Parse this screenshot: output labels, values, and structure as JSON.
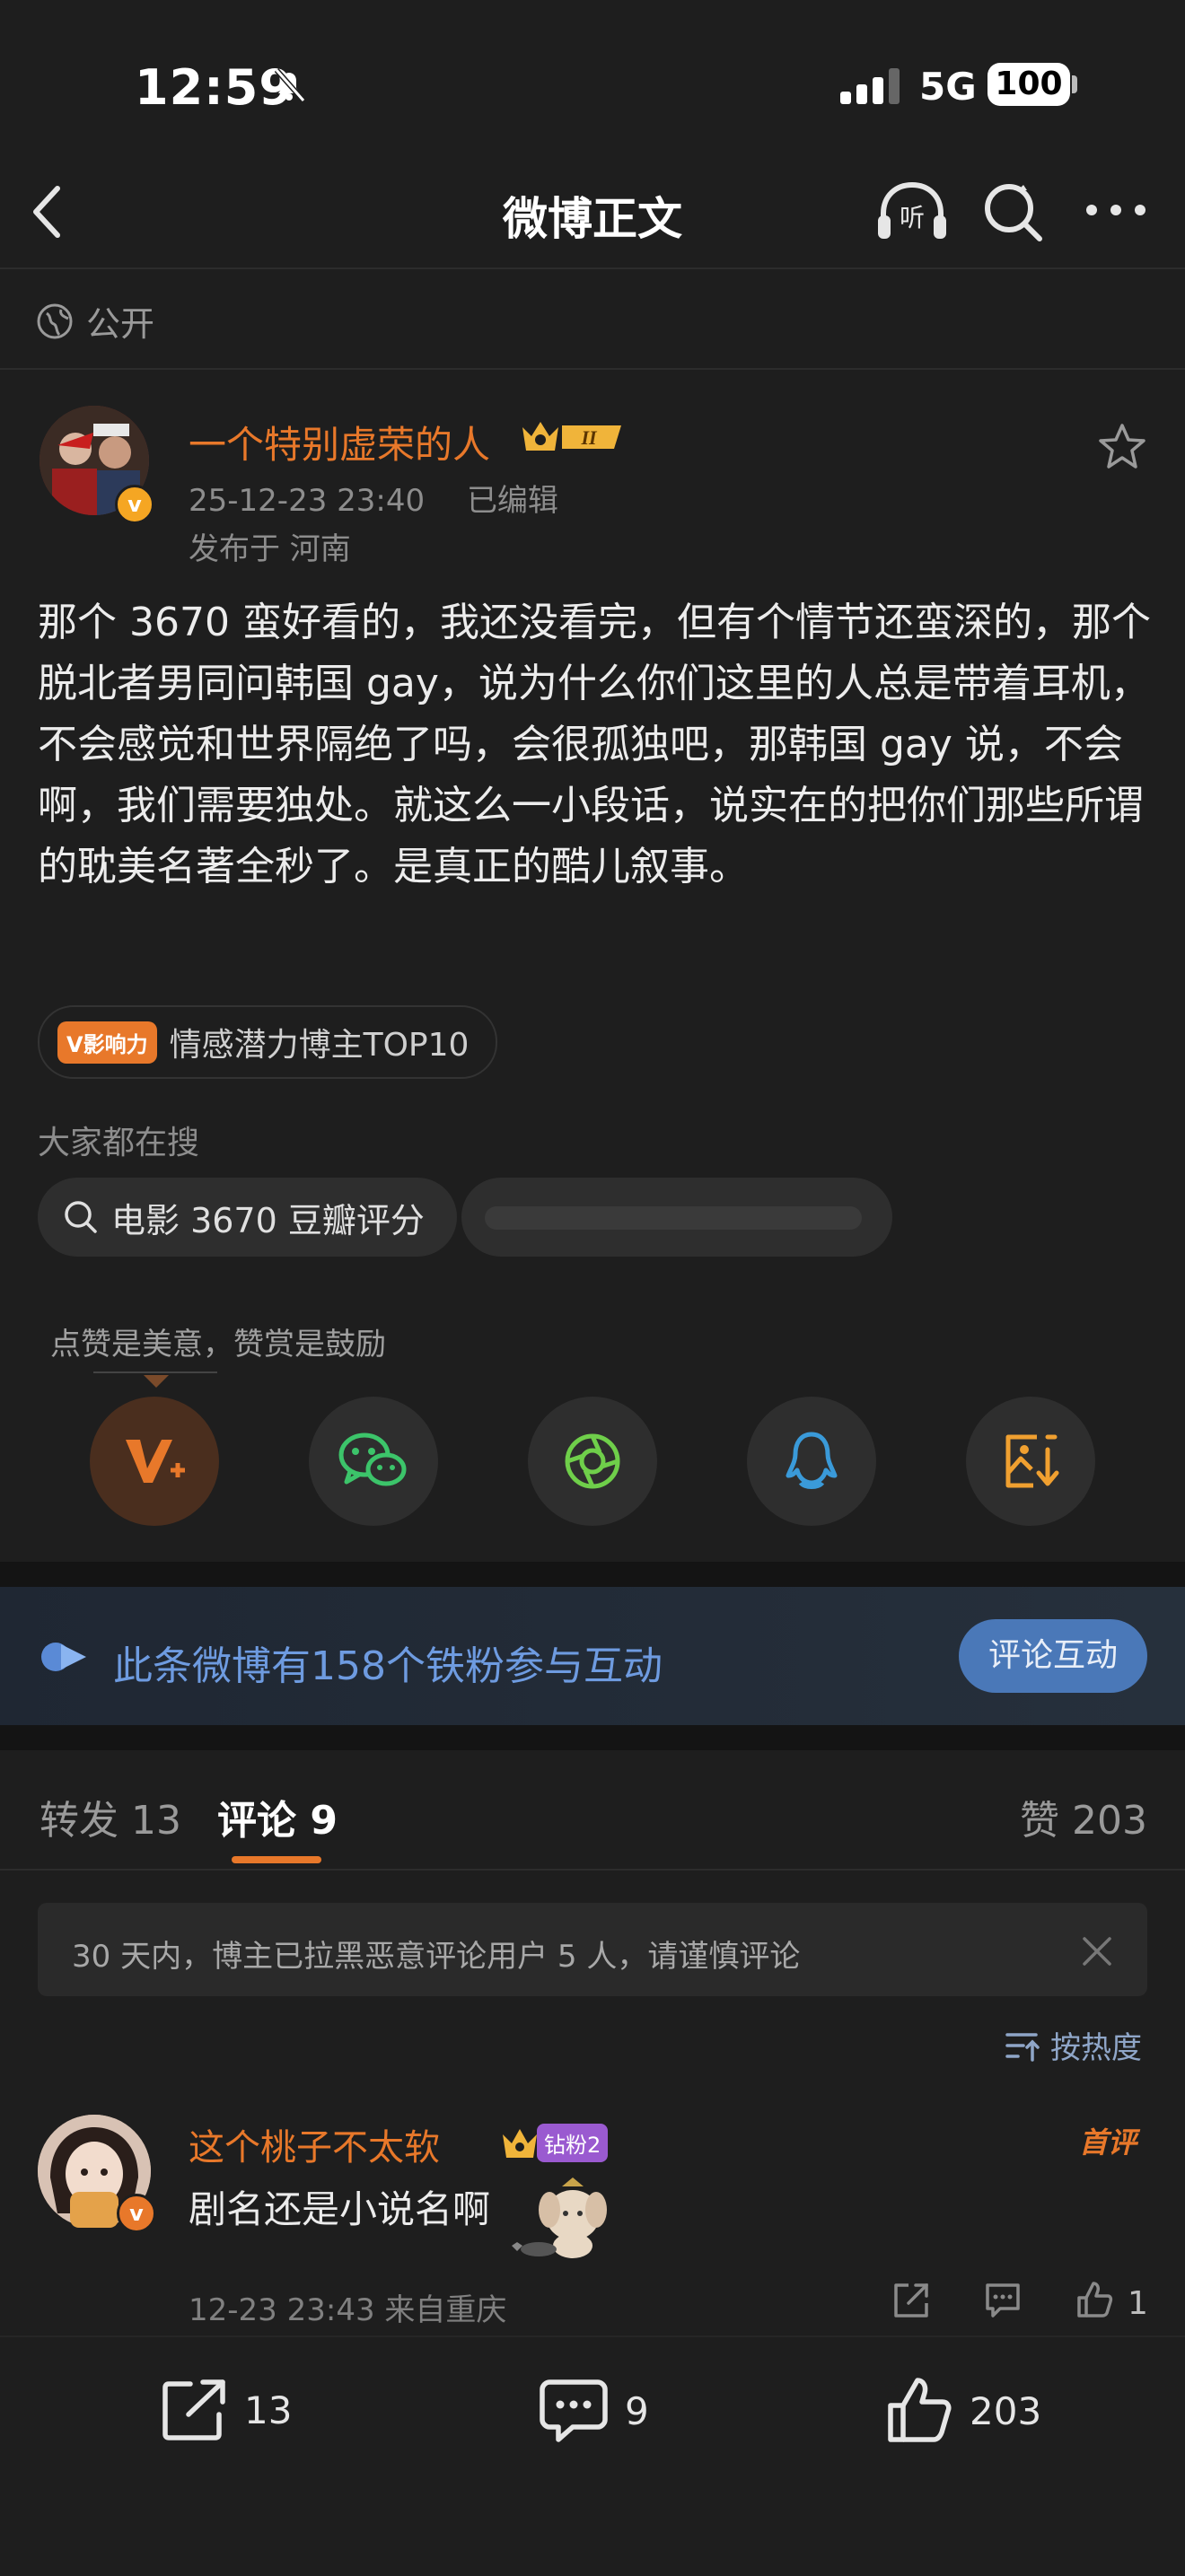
{
  "status_bar": {
    "time": "12:59",
    "network": "5G",
    "battery": "100"
  },
  "header": {
    "title": "微博正文",
    "listen_label": "听"
  },
  "visibility": "公开",
  "author": {
    "name": "一个特别虚荣的人",
    "level_badge": "II",
    "datetime": "25-12-23 23:40",
    "edited": "已编辑",
    "location": "发布于 河南"
  },
  "post": {
    "text": "那个 3670 蛮好看的，我还没看完，但有个情节还蛮深的，那个脱北者男同问韩国 gay，说为什么你们这里的人总是带着耳机，不会感觉和世界隔绝了吗，会很孤独吧，那韩国 gay 说，不会啊，我们需要独处。就这么一小段话，说实在的把你们那些所谓的耽美名著全秒了。是真正的酷儿叙事。"
  },
  "influence": {
    "tag": "V影响力",
    "label": "情感潜力博主TOP10"
  },
  "trending": {
    "label": "大家都在搜",
    "items": [
      "电影 3670 豆瓣评分"
    ]
  },
  "reward_hint": "点赞是美意，赞赏是鼓励",
  "share": {
    "items": [
      {
        "icon": "v-plus-reward-icon"
      },
      {
        "icon": "wechat-icon"
      },
      {
        "icon": "moments-icon"
      },
      {
        "icon": "qq-icon"
      },
      {
        "icon": "save-image-icon"
      }
    ]
  },
  "banner": {
    "text": "此条微博有158个铁粉参与互动",
    "button": "评论互动"
  },
  "tabs": {
    "repost": "转发 13",
    "comments": "评论 9",
    "likes": "赞 203"
  },
  "notice": "30 天内，博主已拉黑恶意评论用户 5 人，请谨慎评论",
  "sort_label": "按热度",
  "comment": {
    "name": "这个桃子不太软",
    "fan_badge": "钻粉2",
    "tag": "首评",
    "text": "剧名还是小说名啊",
    "meta": "12-23 23:43  来自重庆",
    "likes": "1"
  },
  "bottom_bar": {
    "repost": "13",
    "comment": "9",
    "like": "203"
  },
  "colors": {
    "accent": "#e8782a",
    "link_blue": "#6e9be0",
    "background": "#1e1e1e"
  }
}
